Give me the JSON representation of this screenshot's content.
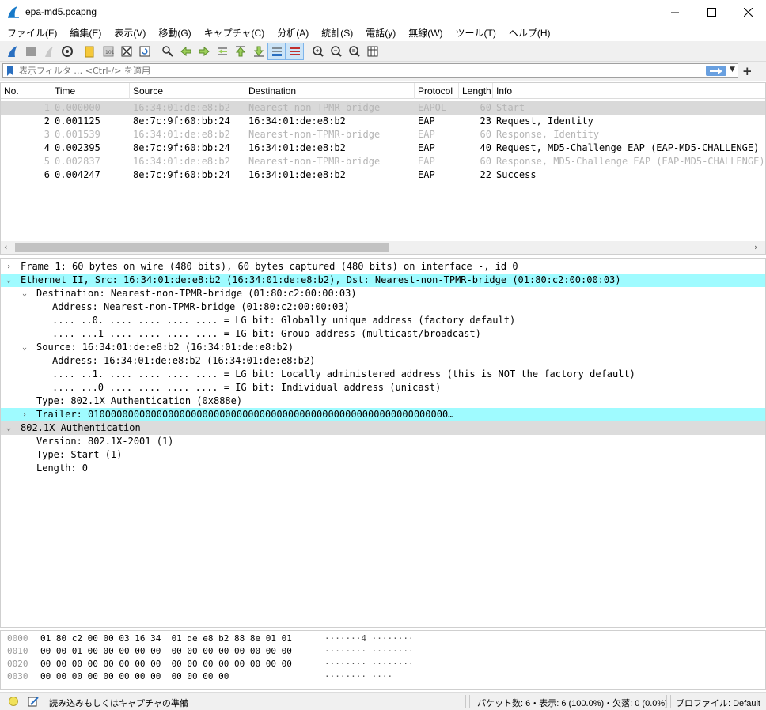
{
  "window": {
    "title": "epa-md5.pcapng",
    "minimize": "—",
    "maximize": "☐",
    "close": "✕"
  },
  "menu": [
    "ファイル(F)",
    "編集(E)",
    "表示(V)",
    "移動(G)",
    "キャプチャ(C)",
    "分析(A)",
    "統計(S)",
    "電話(y)",
    "無線(W)",
    "ツール(T)",
    "ヘルプ(H)"
  ],
  "filter": {
    "placeholder": "表示フィルタ … <Ctrl-/> を適用"
  },
  "columns": [
    "No.",
    "Time",
    "Source",
    "Destination",
    "Protocol",
    "Length",
    "Info"
  ],
  "packets": [
    {
      "no": "1",
      "time": "0.000000",
      "src": "16:34:01:de:e8:b2",
      "dst": "Nearest-non-TPMR-bridge",
      "proto": "EAPOL",
      "len": "60",
      "info": "Start",
      "dim": true,
      "selected": true
    },
    {
      "no": "2",
      "time": "0.001125",
      "src": "8e:7c:9f:60:bb:24",
      "dst": "16:34:01:de:e8:b2",
      "proto": "EAP",
      "len": "23",
      "info": "Request, Identity",
      "dim": false
    },
    {
      "no": "3",
      "time": "0.001539",
      "src": "16:34:01:de:e8:b2",
      "dst": "Nearest-non-TPMR-bridge",
      "proto": "EAP",
      "len": "60",
      "info": "Response, Identity",
      "dim": true
    },
    {
      "no": "4",
      "time": "0.002395",
      "src": "8e:7c:9f:60:bb:24",
      "dst": "16:34:01:de:e8:b2",
      "proto": "EAP",
      "len": "40",
      "info": "Request, MD5-Challenge EAP (EAP-MD5-CHALLENGE)",
      "dim": false
    },
    {
      "no": "5",
      "time": "0.002837",
      "src": "16:34:01:de:e8:b2",
      "dst": "Nearest-non-TPMR-bridge",
      "proto": "EAP",
      "len": "60",
      "info": "Response, MD5-Challenge EAP (EAP-MD5-CHALLENGE)",
      "dim": true
    },
    {
      "no": "6",
      "time": "0.004247",
      "src": "8e:7c:9f:60:bb:24",
      "dst": "16:34:01:de:e8:b2",
      "proto": "EAP",
      "len": "22",
      "info": "Success",
      "dim": false
    }
  ],
  "details": [
    {
      "level": 0,
      "arrow": "›",
      "text": "Frame 1: 60 bytes on wire (480 bits), 60 bytes captured (480 bits) on interface -, id 0",
      "style": ""
    },
    {
      "level": 0,
      "arrow": "⌄",
      "text": "Ethernet II, Src: 16:34:01:de:e8:b2 (16:34:01:de:e8:b2), Dst: Nearest-non-TPMR-bridge (01:80:c2:00:00:03)",
      "style": "hl"
    },
    {
      "level": 1,
      "arrow": "⌄",
      "text": "Destination: Nearest-non-TPMR-bridge (01:80:c2:00:00:03)",
      "style": ""
    },
    {
      "level": 2,
      "arrow": "",
      "text": "Address: Nearest-non-TPMR-bridge (01:80:c2:00:00:03)",
      "style": ""
    },
    {
      "level": 2,
      "arrow": "",
      "text": ".... ..0. .... .... .... .... = LG bit: Globally unique address (factory default)",
      "style": ""
    },
    {
      "level": 2,
      "arrow": "",
      "text": ".... ...1 .... .... .... .... = IG bit: Group address (multicast/broadcast)",
      "style": ""
    },
    {
      "level": 1,
      "arrow": "⌄",
      "text": "Source: 16:34:01:de:e8:b2 (16:34:01:de:e8:b2)",
      "style": ""
    },
    {
      "level": 2,
      "arrow": "",
      "text": "Address: 16:34:01:de:e8:b2 (16:34:01:de:e8:b2)",
      "style": ""
    },
    {
      "level": 2,
      "arrow": "",
      "text": ".... ..1. .... .... .... .... = LG bit: Locally administered address (this is NOT the factory default)",
      "style": ""
    },
    {
      "level": 2,
      "arrow": "",
      "text": ".... ...0 .... .... .... .... = IG bit: Individual address (unicast)",
      "style": ""
    },
    {
      "level": 1,
      "arrow": "",
      "text": "Type: 802.1X Authentication (0x888e)",
      "style": ""
    },
    {
      "level": 1,
      "arrow": "›",
      "text": "Trailer: 010000000000000000000000000000000000000000000000000000000000000…",
      "style": "hl"
    },
    {
      "level": 0,
      "arrow": "⌄",
      "text": "802.1X Authentication",
      "style": "sub"
    },
    {
      "level": 1,
      "arrow": "",
      "text": "Version: 802.1X-2001 (1)",
      "style": ""
    },
    {
      "level": 1,
      "arrow": "",
      "text": "Type: Start (1)",
      "style": ""
    },
    {
      "level": 1,
      "arrow": "",
      "text": "Length: 0",
      "style": ""
    }
  ],
  "bytes": [
    {
      "off": "0000",
      "hex": "01 80 c2 00 00 03 16 34  01 de e8 b2 88 8e 01 01",
      "ascii": "·······4 ········"
    },
    {
      "off": "0010",
      "hex": "00 00 01 00 00 00 00 00  00 00 00 00 00 00 00 00",
      "ascii": "········ ········"
    },
    {
      "off": "0020",
      "hex": "00 00 00 00 00 00 00 00  00 00 00 00 00 00 00 00",
      "ascii": "········ ········"
    },
    {
      "off": "0030",
      "hex": "00 00 00 00 00 00 00 00  00 00 00 00",
      "ascii": "········ ····"
    }
  ],
  "status": {
    "ready": "読み込みもしくはキャプチャの準備",
    "packets": "パケット数: 6・表示: 6 (100.0%)・欠落: 0 (0.0%)",
    "profile": "プロファイル: Default"
  },
  "colors": {
    "highlight": "#9ffbff",
    "selected": "#d9d9d9",
    "dim": "#b5b5b5"
  }
}
